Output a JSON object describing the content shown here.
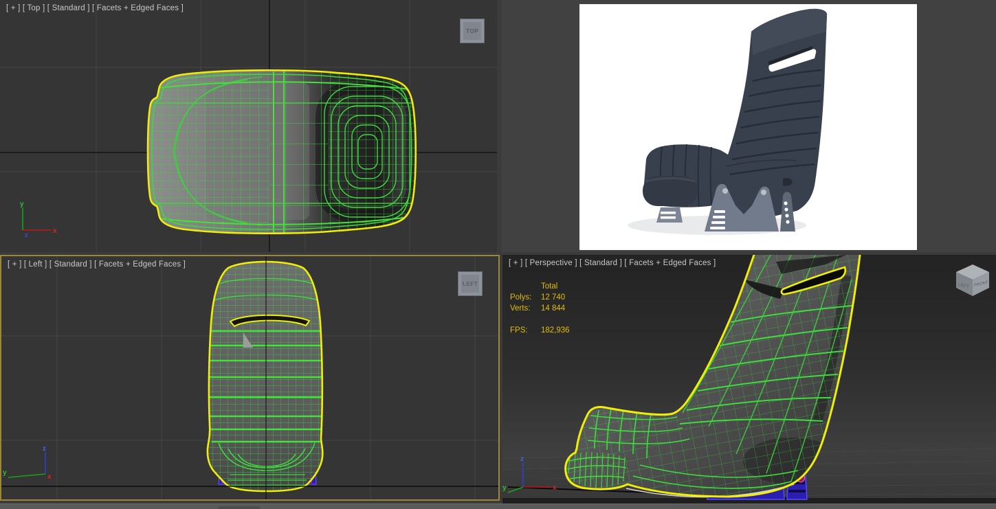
{
  "viewports": {
    "top": {
      "label": "[ + ] [ Top ] [ Standard ] [ Facets + Edged Faces ]",
      "viewcube_label": "TOP",
      "axis": {
        "x": "x",
        "y": "y",
        "z": "z"
      }
    },
    "render": {},
    "left": {
      "label": "[ + ] [ Left ] [ Standard ] [ Facets + Edged Faces ]",
      "viewcube_label": "LEFT",
      "axis": {
        "x": "x",
        "y": "y",
        "z": "z"
      }
    },
    "perspective": {
      "label": "[ + ] [ Perspective ] [ Standard ] [ Facets + Edged Faces ]",
      "viewcube": {
        "left_face": "LEFT",
        "front_face": "FRONT"
      },
      "axis": {
        "x": "x",
        "y": "y",
        "z": "z"
      },
      "stats": {
        "total_header": "Total",
        "polys_label": "Polys:",
        "polys_value": "12 740",
        "verts_label": "Verts:",
        "verts_value": "14 844",
        "fps_label": "FPS:",
        "fps_value": "182,936"
      }
    }
  },
  "colors": {
    "wireframe_green": "#3dd23d",
    "selection_yellow": "#f0ee08",
    "unselected_blue": "#2a1fb0",
    "stats_yellow": "#e0bd06",
    "active_border": "#9a8739",
    "viewport_bg": "#353535"
  }
}
